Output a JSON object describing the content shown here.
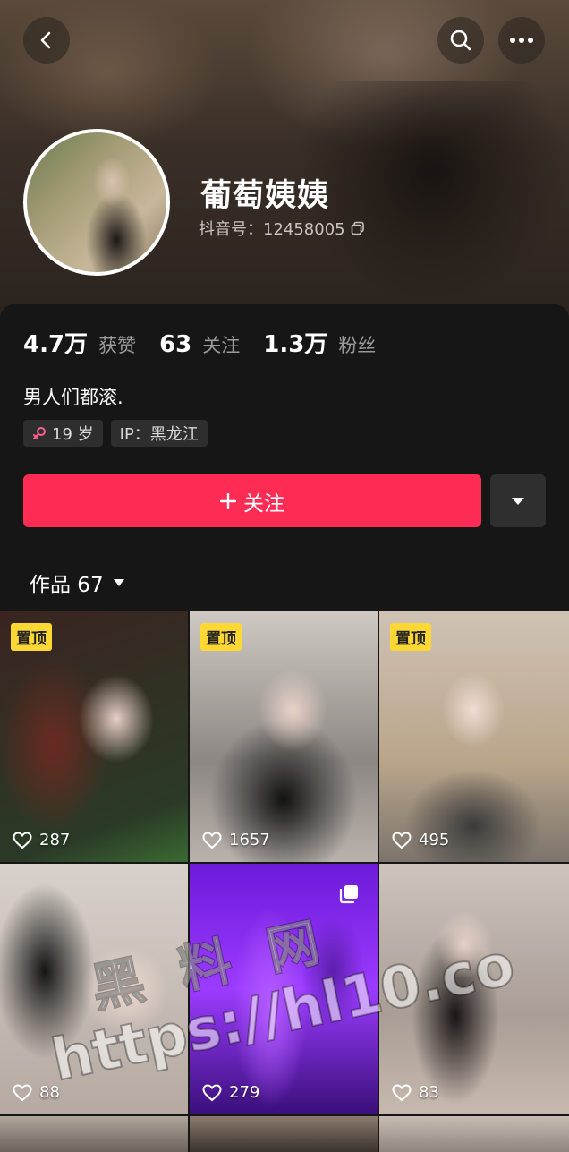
{
  "profile": {
    "name": "葡萄姨姨",
    "douyin_id": "抖音号：12458005"
  },
  "stats": [
    {
      "value": "4.7万",
      "label": "获赞"
    },
    {
      "value": "63",
      "label": "关注"
    },
    {
      "value": "1.3万",
      "label": "粉丝"
    }
  ],
  "bio": "男人们都滚.",
  "tags": {
    "age": "19 岁",
    "ip": "IP：黑龙江"
  },
  "actions": {
    "follow_label": "关注"
  },
  "works": {
    "label": "作品 67",
    "items": [
      {
        "pinned_label": "置顶",
        "likes": "287"
      },
      {
        "pinned_label": "置顶",
        "likes": "1657"
      },
      {
        "pinned_label": "置顶",
        "likes": "495"
      },
      {
        "likes": "88"
      },
      {
        "likes": "279"
      },
      {
        "likes": "83"
      }
    ]
  },
  "watermark": {
    "chinese": "黑料网",
    "url": "https://hl10.co"
  },
  "colors": {
    "accent": "#fe2c55",
    "pin_badge": "#fdd835",
    "background": "#161616"
  }
}
